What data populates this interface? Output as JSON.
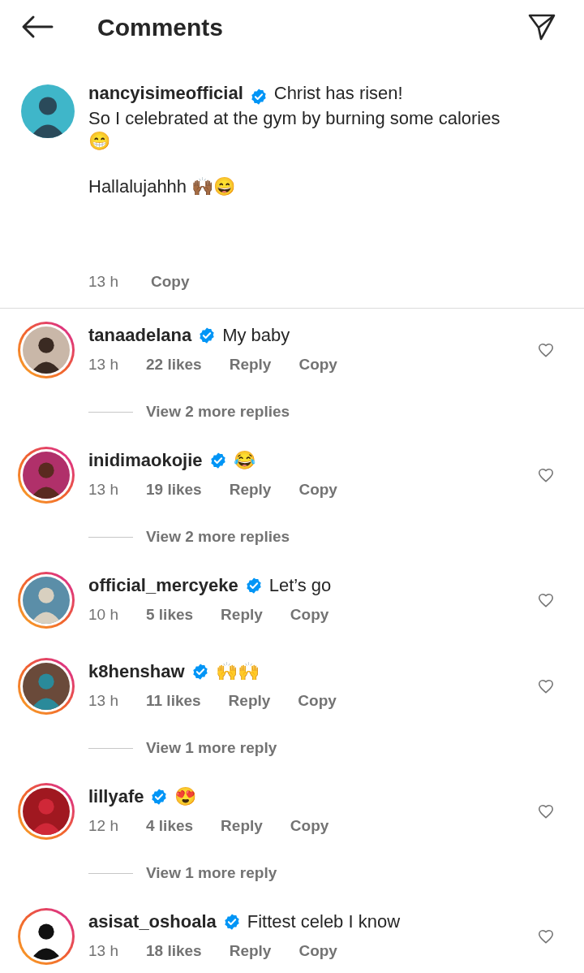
{
  "header": {
    "title": "Comments"
  },
  "post": {
    "username": "nancyisimeofficial",
    "verified": true,
    "has_story": false,
    "text": "Christ has risen!\nSo I celebrated at the gym by burning some calories\n😁\n\nHallalujahhh 🙌🏾😄",
    "time": "13 h",
    "actions": [
      "Copy"
    ]
  },
  "comments": [
    {
      "username": "tanaadelana",
      "verified": true,
      "has_story": true,
      "text": "My baby",
      "time": "13 h",
      "likes": "22 likes",
      "actions": [
        "Reply",
        "Copy"
      ],
      "liked": false,
      "replies": "View 2 more replies"
    },
    {
      "username": "inidimaokojie",
      "verified": true,
      "has_story": true,
      "text": "😂",
      "time": "13 h",
      "likes": "19 likes",
      "actions": [
        "Reply",
        "Copy"
      ],
      "liked": false,
      "replies": "View 2 more replies"
    },
    {
      "username": "official_mercyeke",
      "verified": true,
      "has_story": true,
      "text": "Let’s go",
      "time": "10 h",
      "likes": "5 likes",
      "actions": [
        "Reply",
        "Copy"
      ],
      "liked": false
    },
    {
      "username": "k8henshaw",
      "verified": true,
      "has_story": true,
      "text": "🙌🙌",
      "time": "13 h",
      "likes": "11 likes",
      "actions": [
        "Reply",
        "Copy"
      ],
      "liked": false,
      "replies": "View 1 more reply"
    },
    {
      "username": "lillyafe",
      "verified": true,
      "has_story": true,
      "text": "😍",
      "time": "12 h",
      "likes": "4 likes",
      "actions": [
        "Reply",
        "Copy"
      ],
      "liked": false,
      "replies": "View 1 more reply"
    },
    {
      "username": "asisat_oshoala",
      "verified": true,
      "has_story": true,
      "text": "Fittest celeb I know",
      "time": "13 h",
      "likes": "18 likes",
      "actions": [
        "Reply",
        "Copy"
      ],
      "liked": false
    }
  ]
}
